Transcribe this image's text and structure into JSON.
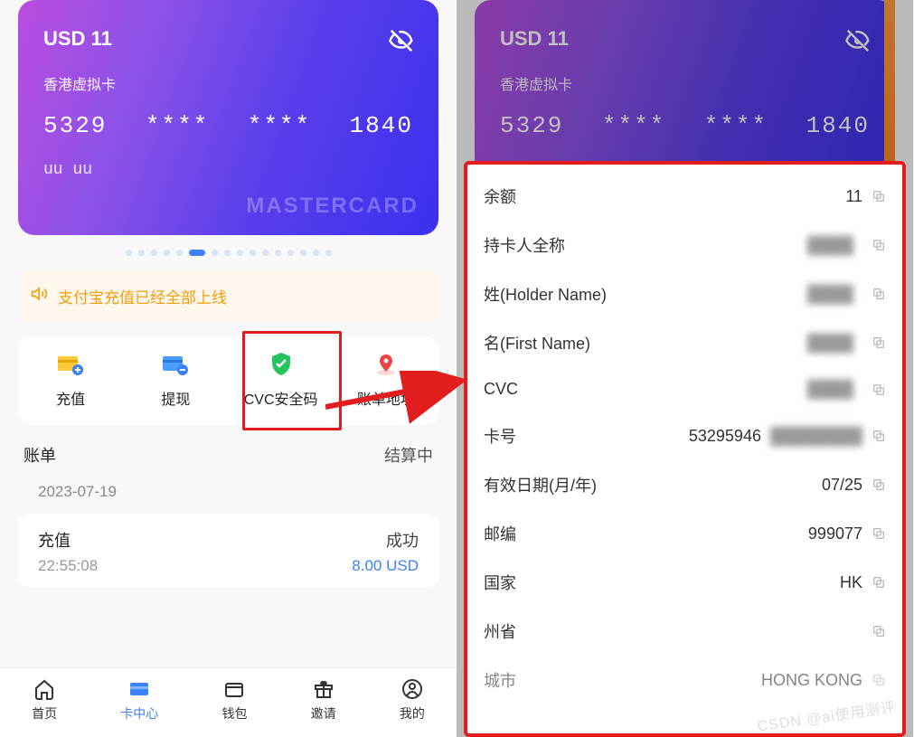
{
  "card": {
    "balance": "USD 11",
    "name": "香港虚拟卡",
    "digits": [
      "5329",
      "****",
      "****",
      "1840"
    ],
    "holder": "uu uu",
    "brand": "MASTERCARD"
  },
  "notice": "支付宝充值已经全部上线",
  "actions": [
    {
      "label": "充值",
      "icon": "recharge-icon"
    },
    {
      "label": "提现",
      "icon": "withdraw-icon"
    },
    {
      "label": "CVC安全码",
      "icon": "shield-check-icon"
    },
    {
      "label": "账单地址",
      "icon": "location-icon"
    }
  ],
  "bills": {
    "title": "账单",
    "status": "结算中",
    "date": "2023-07-19",
    "item": {
      "type": "充值",
      "result": "成功",
      "time": "22:55:08",
      "amount": "8.00 USD"
    }
  },
  "tabs": [
    {
      "label": "首页",
      "icon": "home-icon"
    },
    {
      "label": "卡中心",
      "icon": "card-icon",
      "active": true
    },
    {
      "label": "钱包",
      "icon": "wallet-icon"
    },
    {
      "label": "邀请",
      "icon": "gift-icon"
    },
    {
      "label": "我的",
      "icon": "person-icon"
    }
  ],
  "modal": [
    {
      "label": "余额",
      "value": "11"
    },
    {
      "label": "持卡人全称",
      "value": "",
      "blurred": true
    },
    {
      "label": "姓(Holder Name)",
      "value": "",
      "blurred": true
    },
    {
      "label": "名(First Name)",
      "value": "",
      "blurred": true
    },
    {
      "label": "CVC",
      "value": "",
      "blurred": true
    },
    {
      "label": "卡号",
      "value": "53295946",
      "blurred_suffix": true
    },
    {
      "label": "有效日期(月/年)",
      "value": "07/25"
    },
    {
      "label": "邮编",
      "value": "999077"
    },
    {
      "label": "国家",
      "value": "HK"
    },
    {
      "label": "州省",
      "value": ""
    },
    {
      "label": "城市",
      "value": "HONG KONG",
      "cutoff": true
    }
  ],
  "watermark": "CSDN @ai使用测评"
}
